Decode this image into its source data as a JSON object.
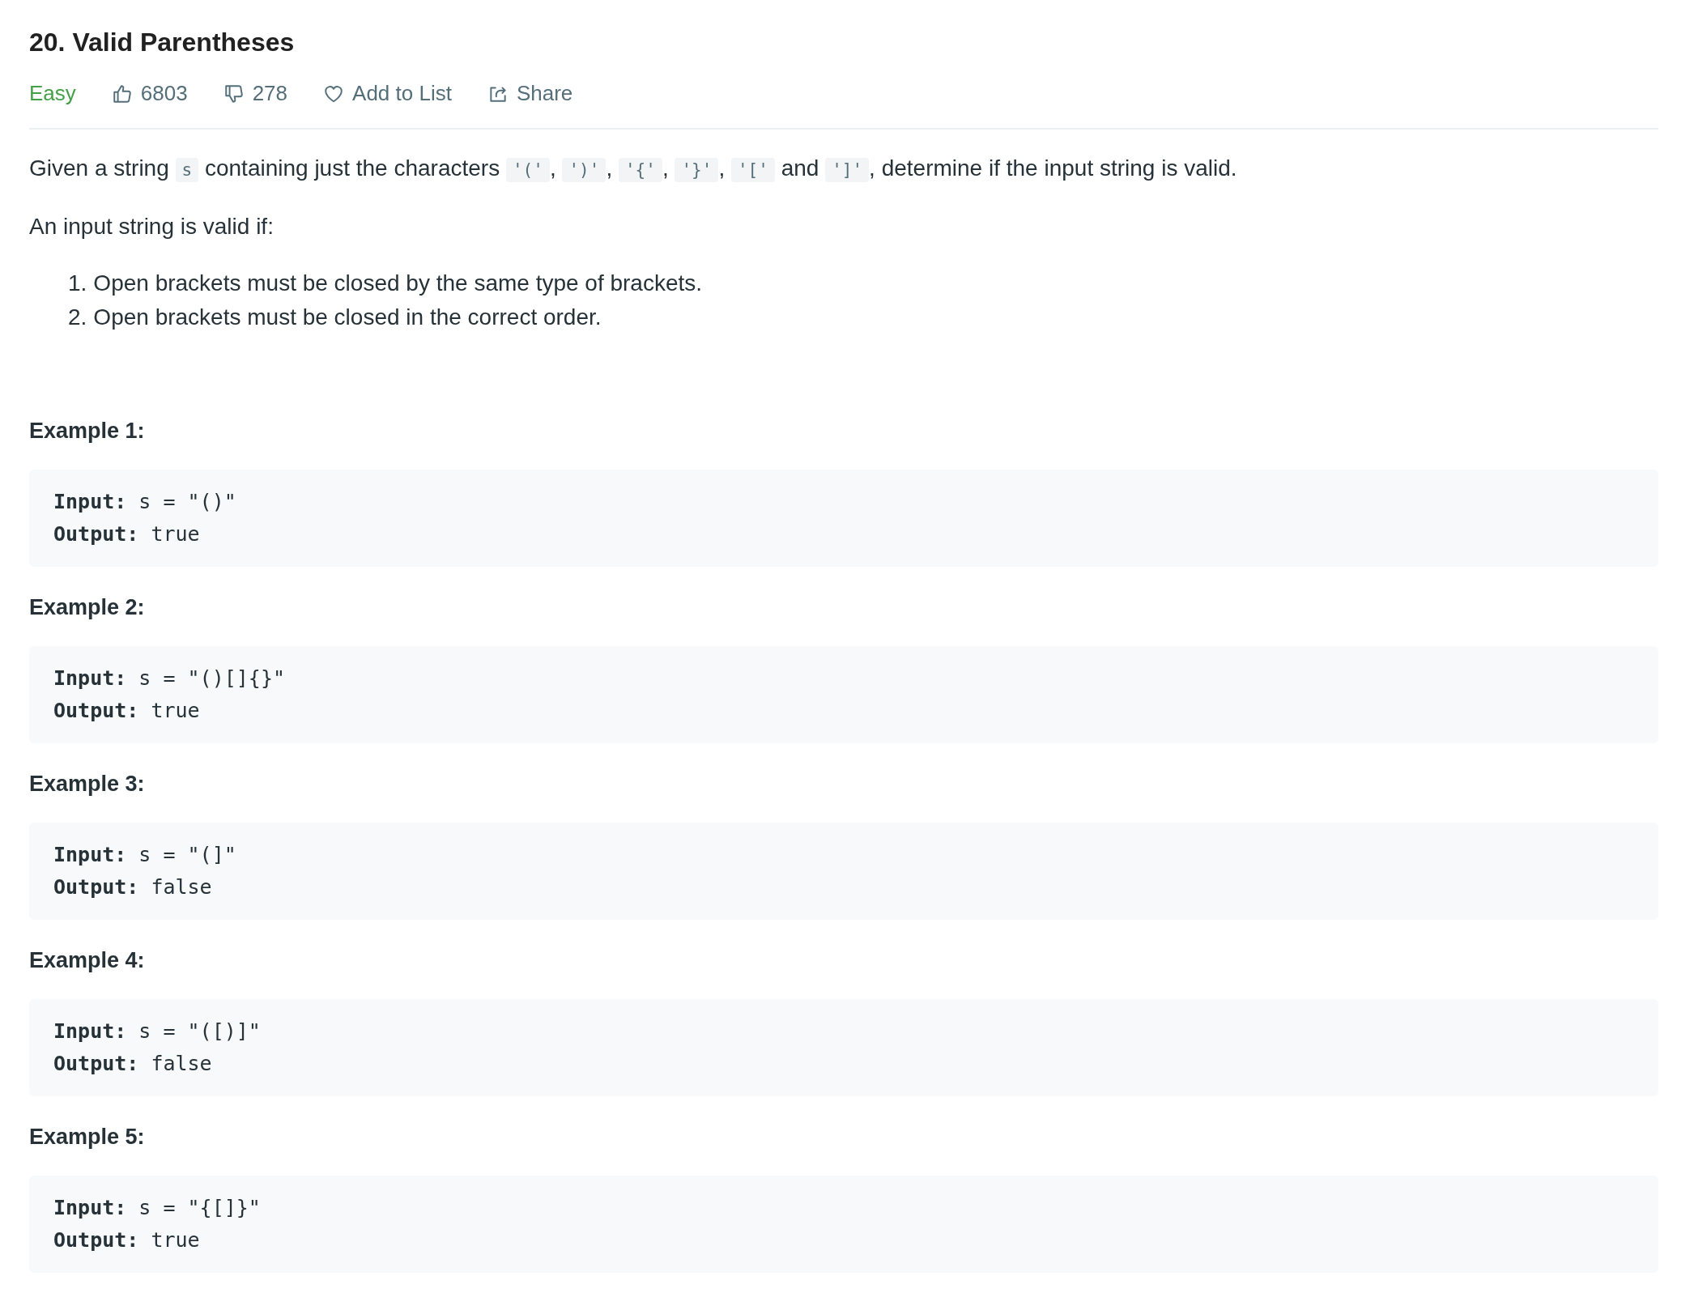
{
  "title": "20. Valid Parentheses",
  "difficulty": "Easy",
  "actions": [
    {
      "kind": "like",
      "label": "6803"
    },
    {
      "kind": "dislike",
      "label": "278"
    },
    {
      "kind": "favorite",
      "label": "Add to List"
    },
    {
      "kind": "share",
      "label": "Share"
    }
  ],
  "description": [
    {
      "kind": "text",
      "text": "Given a string "
    },
    {
      "kind": "code",
      "text": "s"
    },
    {
      "kind": "text",
      "text": " containing just the characters "
    },
    {
      "kind": "code",
      "text": "'('"
    },
    {
      "kind": "text",
      "text": ", "
    },
    {
      "kind": "code",
      "text": "')'"
    },
    {
      "kind": "text",
      "text": ", "
    },
    {
      "kind": "code",
      "text": "'{'"
    },
    {
      "kind": "text",
      "text": ", "
    },
    {
      "kind": "code",
      "text": "'}'"
    },
    {
      "kind": "text",
      "text": ", "
    },
    {
      "kind": "code",
      "text": "'['"
    },
    {
      "kind": "text",
      "text": " and "
    },
    {
      "kind": "code",
      "text": "']'"
    },
    {
      "kind": "text",
      "text": ", determine if the input string is valid."
    }
  ],
  "rules_intro": "An input string is valid if:",
  "rules": [
    {
      "number": "1.",
      "text": "Open brackets must be closed by the same type of brackets."
    },
    {
      "number": "2.",
      "text": "Open brackets must be closed in the correct order."
    }
  ],
  "examples": [
    {
      "title": "Example 1:",
      "lines": [
        {
          "label": "Input:",
          "value": "s = \"()\""
        },
        {
          "label": "Output:",
          "value": "true"
        }
      ]
    },
    {
      "title": "Example 2:",
      "lines": [
        {
          "label": "Input:",
          "value": "s = \"()[]{}\""
        },
        {
          "label": "Output:",
          "value": "true"
        }
      ]
    },
    {
      "title": "Example 3:",
      "lines": [
        {
          "label": "Input:",
          "value": "s = \"(]\""
        },
        {
          "label": "Output:",
          "value": "false"
        }
      ]
    },
    {
      "title": "Example 4:",
      "lines": [
        {
          "label": "Input:",
          "value": "s = \"([)]\""
        },
        {
          "label": "Output:",
          "value": "false"
        }
      ]
    },
    {
      "title": "Example 5:",
      "lines": [
        {
          "label": "Input:",
          "value": "s = \"{[]}\""
        },
        {
          "label": "Output:",
          "value": "true"
        }
      ]
    }
  ]
}
